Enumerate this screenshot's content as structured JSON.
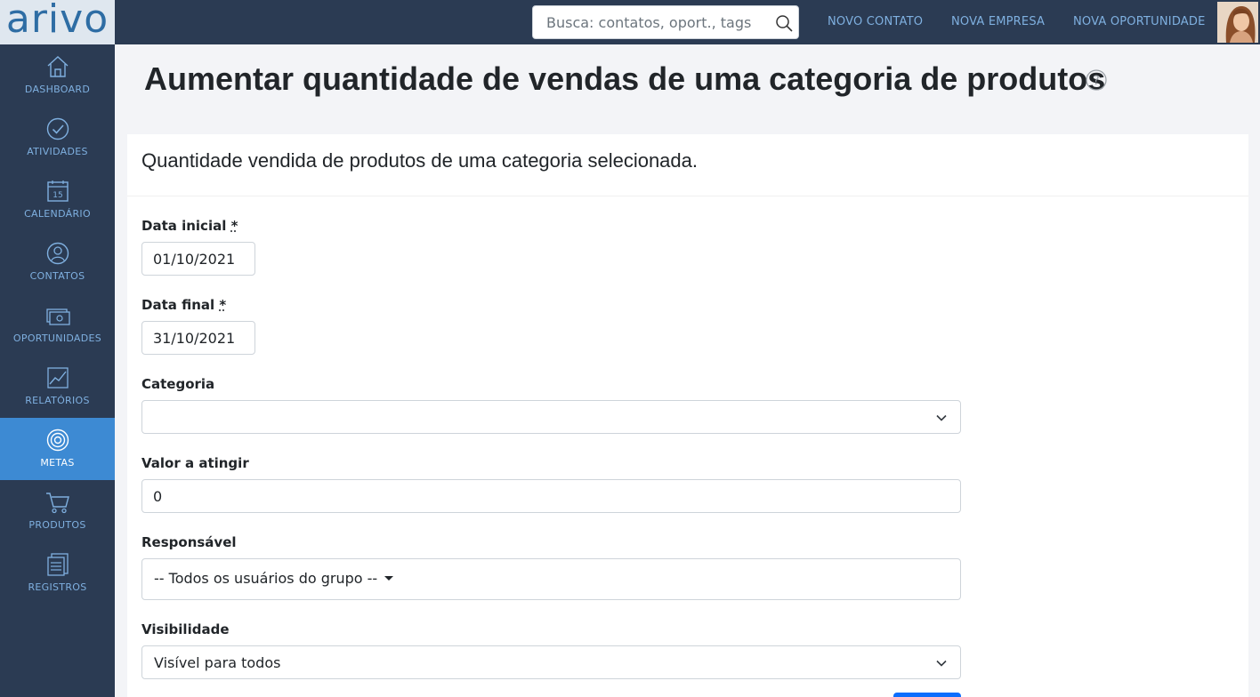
{
  "brand": {
    "logo_text": "arivo"
  },
  "header": {
    "search_placeholder": "Busca: contatos, oport., tags",
    "links": [
      {
        "label": "NOVO CONTATO"
      },
      {
        "label": "NOVA EMPRESA"
      },
      {
        "label": "NOVA OPORTUNIDADE"
      }
    ]
  },
  "sidebar": {
    "items": [
      {
        "label": "DASHBOARD",
        "icon": "home-icon"
      },
      {
        "label": "ATIVIDADES",
        "icon": "check-circle-icon"
      },
      {
        "label": "CALENDÁRIO",
        "icon": "calendar-icon",
        "day": "15"
      },
      {
        "label": "CONTATOS",
        "icon": "user-icon"
      },
      {
        "label": "OPORTUNIDADES",
        "icon": "money-icon"
      },
      {
        "label": "RELATÓRIOS",
        "icon": "chart-icon"
      },
      {
        "label": "METAS",
        "icon": "target-icon",
        "active": true
      },
      {
        "label": "PRODUTOS",
        "icon": "cart-icon"
      },
      {
        "label": "REGISTROS",
        "icon": "records-icon"
      }
    ]
  },
  "page": {
    "title": "Aumentar quantidade de vendas de uma categoria de produtos",
    "subtitle": "Quantidade vendida de produtos de uma categoria selecionada."
  },
  "form": {
    "required_mark": "*",
    "start_date": {
      "label": "Data inicial",
      "value": "01/10/2021"
    },
    "end_date": {
      "label": "Data final",
      "value": "31/10/2021"
    },
    "category": {
      "label": "Categoria",
      "value": ""
    },
    "target_value": {
      "label": "Valor a atingir",
      "value": "0"
    },
    "owner": {
      "label": "Responsável",
      "value": "-- Todos os usuários do grupo --"
    },
    "visibility": {
      "label": "Visibilidade",
      "value": "Visível para todos"
    }
  },
  "colors": {
    "sidebar_bg": "#2b3b53",
    "active_item": "#3d8ad3",
    "link": "#7fb0e0",
    "primary_button": "#0d6efd"
  }
}
